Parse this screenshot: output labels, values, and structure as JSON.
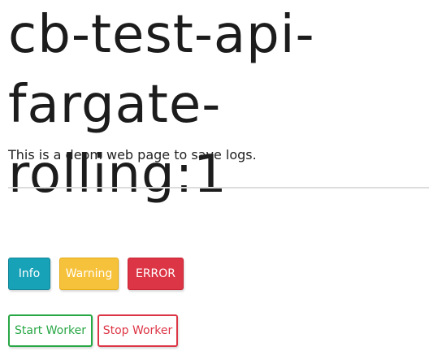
{
  "header": {
    "title": "cb-test-api-fargate-rolling:1",
    "subtitle": "This is a deom web page to save logs."
  },
  "log_buttons": {
    "info_label": "Info",
    "warning_label": "Warning",
    "error_label": "ERROR"
  },
  "worker_buttons": {
    "start_label": "Start Worker",
    "stop_label": "Stop Worker"
  },
  "colors": {
    "info": "#17a2b8",
    "warning": "#f7c23b",
    "error": "#dc3545",
    "success": "#28a745",
    "divider": "#dcdcdc"
  }
}
